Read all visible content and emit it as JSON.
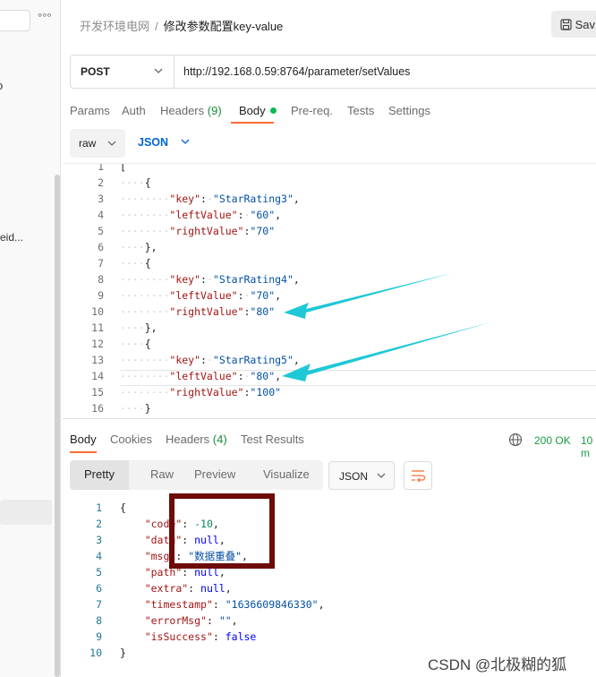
{
  "sidebar": {
    "dots": "°°°",
    "tail_text_1": "o",
    "tail_text_2": "eid..."
  },
  "header": {
    "breadcrumb_parent": "开发环境电网",
    "breadcrumb_sep": "/",
    "breadcrumb_current": "修改参数配置key-value",
    "save_label": "Sav"
  },
  "request": {
    "method": "POST",
    "url": "http://192.168.0.59:8764/parameter/setValues"
  },
  "request_tabs": {
    "params": "Params",
    "auth": "Auth",
    "headers": "Headers",
    "headers_count": "(9)",
    "body": "Body",
    "prereq": "Pre-req.",
    "tests": "Tests",
    "settings": "Settings"
  },
  "body_mode": {
    "raw": "raw",
    "lang": "JSON"
  },
  "request_lines": [
    {
      "num": "1",
      "text": "["
    },
    {
      "num": "2",
      "text": "····{"
    },
    {
      "num": "3",
      "text": "········\"key\":·\"StarRating3\","
    },
    {
      "num": "4",
      "text": "········\"leftValue\":·\"60\","
    },
    {
      "num": "5",
      "text": "········\"rightValue\":\"70\""
    },
    {
      "num": "6",
      "text": "····},"
    },
    {
      "num": "7",
      "text": "····{"
    },
    {
      "num": "8",
      "text": "········\"key\":·\"StarRating4\","
    },
    {
      "num": "9",
      "text": "········\"leftValue\":·\"70\","
    },
    {
      "num": "10",
      "text": "········\"rightValue\":\"80\""
    },
    {
      "num": "11",
      "text": "····},"
    },
    {
      "num": "12",
      "text": "····{"
    },
    {
      "num": "13",
      "text": "········\"key\":·\"StarRating5\","
    },
    {
      "num": "14",
      "text": "········\"leftValue\":·\"80\","
    },
    {
      "num": "15",
      "text": "········\"rightValue\":\"100\""
    },
    {
      "num": "16",
      "text": "····}"
    }
  ],
  "response_tabs": {
    "body": "Body",
    "cookies": "Cookies",
    "headers": "Headers",
    "headers_count": "(4)",
    "test_results": "Test Results"
  },
  "response_status": {
    "code": "200 OK",
    "time": "10 m"
  },
  "response_format": {
    "pretty": "Pretty",
    "raw": "Raw",
    "preview": "Preview",
    "visualize": "Visualize",
    "lang": "JSON"
  },
  "response_lines": [
    {
      "num": "1",
      "text": "{"
    },
    {
      "num": "2",
      "text": "    \"code\": -10,"
    },
    {
      "num": "3",
      "text": "    \"data\": null,"
    },
    {
      "num": "4",
      "text": "    \"msg\": \"数据重叠\","
    },
    {
      "num": "5",
      "text": "    \"path\": null,"
    },
    {
      "num": "6",
      "text": "    \"extra\": null,"
    },
    {
      "num": "7",
      "text": "    \"timestamp\": \"1636609846330\","
    },
    {
      "num": "8",
      "text": "    \"errorMsg\": \"\","
    },
    {
      "num": "9",
      "text": "    \"isSuccess\": false"
    },
    {
      "num": "10",
      "text": "}"
    }
  ],
  "watermark": "CSDN @北极糊的狐",
  "colors": {
    "accent": "#ff6c37",
    "status_ok": "#1a9b43",
    "arrow": "#1ec8d6",
    "callout": "#6e0a0a",
    "link_blue": "#0265d2"
  }
}
